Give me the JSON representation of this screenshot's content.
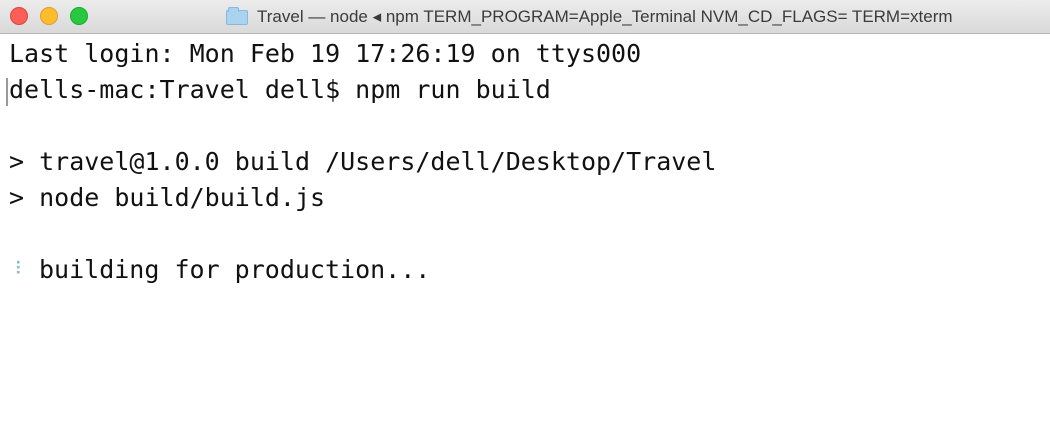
{
  "window": {
    "title": "Travel — node ◂ npm TERM_PROGRAM=Apple_Terminal NVM_CD_FLAGS= TERM=xterm"
  },
  "terminal": {
    "last_login": "Last login: Mon Feb 19 17:26:19 on ttys000",
    "command": "dells-mac:Travel dell$ npm run build",
    "blank1": "",
    "script_line1": "> travel@1.0.0 build /Users/dell/Desktop/Travel",
    "script_line2": "> node build/build.js",
    "blank2": "",
    "spinner": "⠸",
    "status": "building for production..."
  },
  "colors": {
    "close": "#fc5f57",
    "minimize": "#fdbc2e",
    "zoom": "#28c840",
    "background": "#ffffff",
    "text": "#111111"
  },
  "icons": [
    "close-button-icon",
    "minimize-button-icon",
    "zoom-button-icon",
    "folder-icon"
  ]
}
